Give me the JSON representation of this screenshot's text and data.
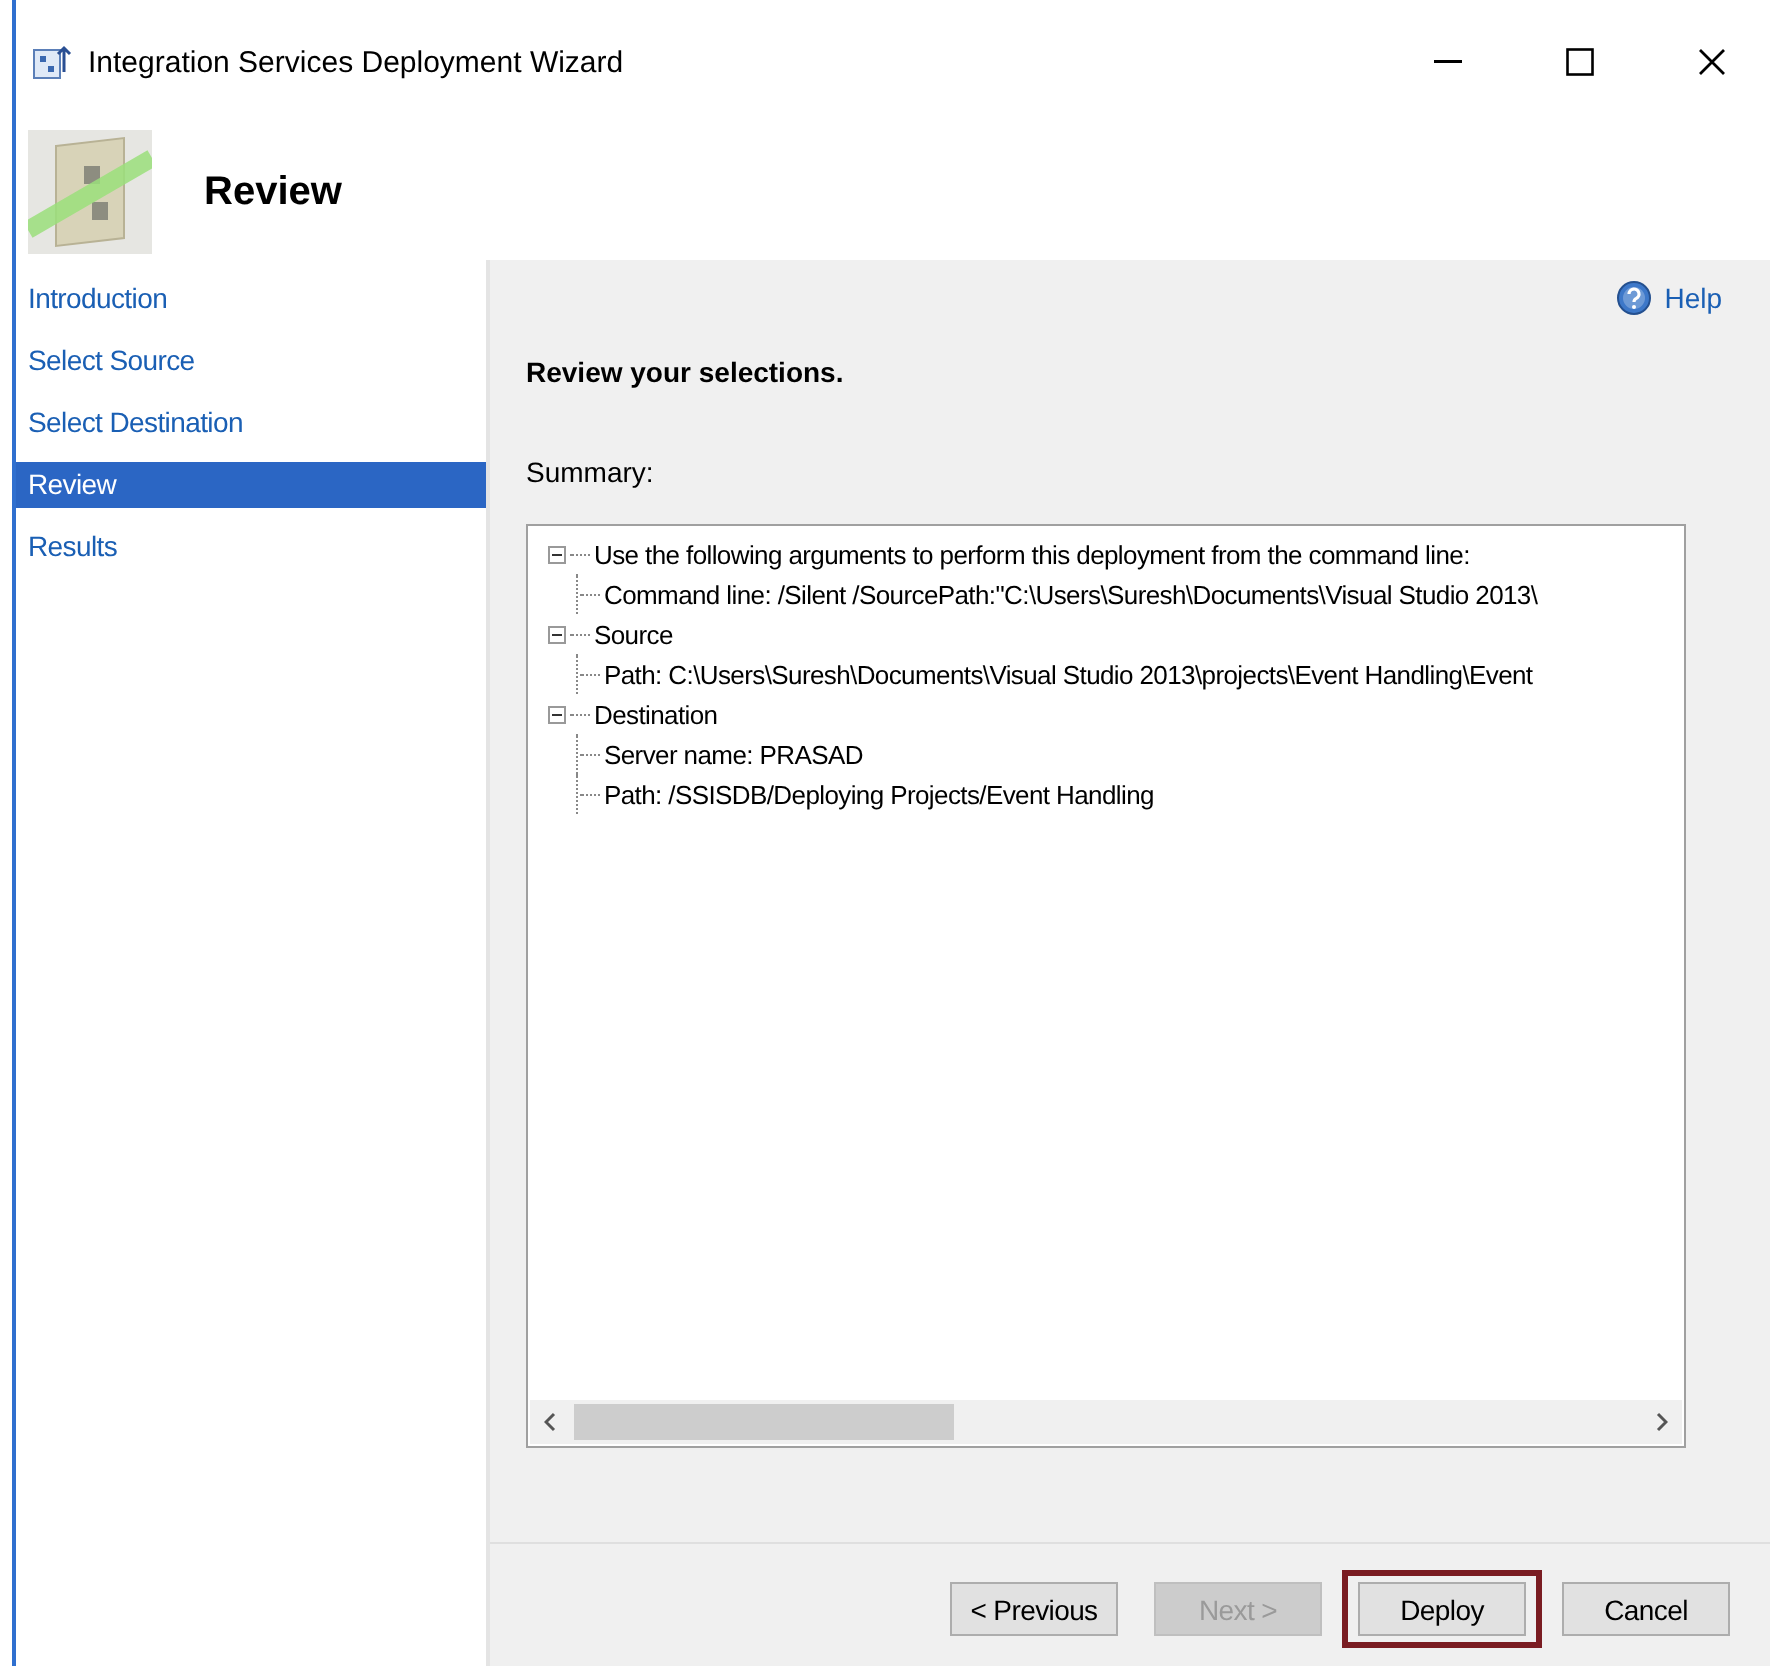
{
  "window": {
    "title": "Integration Services Deployment Wizard"
  },
  "header": {
    "title": "Review"
  },
  "sidebar": {
    "items": [
      {
        "label": "Introduction",
        "selected": false
      },
      {
        "label": "Select Source",
        "selected": false
      },
      {
        "label": "Select Destination",
        "selected": false
      },
      {
        "label": "Review",
        "selected": true
      },
      {
        "label": "Results",
        "selected": false
      }
    ]
  },
  "help": {
    "label": "Help"
  },
  "heading": "Review your selections.",
  "summary_label": "Summary:",
  "summary_tree": [
    {
      "label": "Use the following arguments to perform this deployment from the command line:",
      "expanded": true,
      "children": [
        {
          "label": "Command line: /Silent /SourcePath:\"C:\\Users\\Suresh\\Documents\\Visual Studio 2013\\"
        }
      ]
    },
    {
      "label": "Source",
      "expanded": true,
      "children": [
        {
          "label": "Path: C:\\Users\\Suresh\\Documents\\Visual Studio 2013\\projects\\Event Handling\\Event"
        }
      ]
    },
    {
      "label": "Destination",
      "expanded": true,
      "children": [
        {
          "label": "Server name: PRASAD"
        },
        {
          "label": "Path: /SSISDB/Deploying Projects/Event Handling"
        }
      ]
    }
  ],
  "buttons": [
    {
      "label": "< Previous",
      "disabled": false,
      "highlighted": false
    },
    {
      "label": "Next >",
      "disabled": true,
      "highlighted": false
    },
    {
      "label": "Deploy",
      "disabled": false,
      "highlighted": true
    },
    {
      "label": "Cancel",
      "disabled": false,
      "highlighted": false
    }
  ]
}
